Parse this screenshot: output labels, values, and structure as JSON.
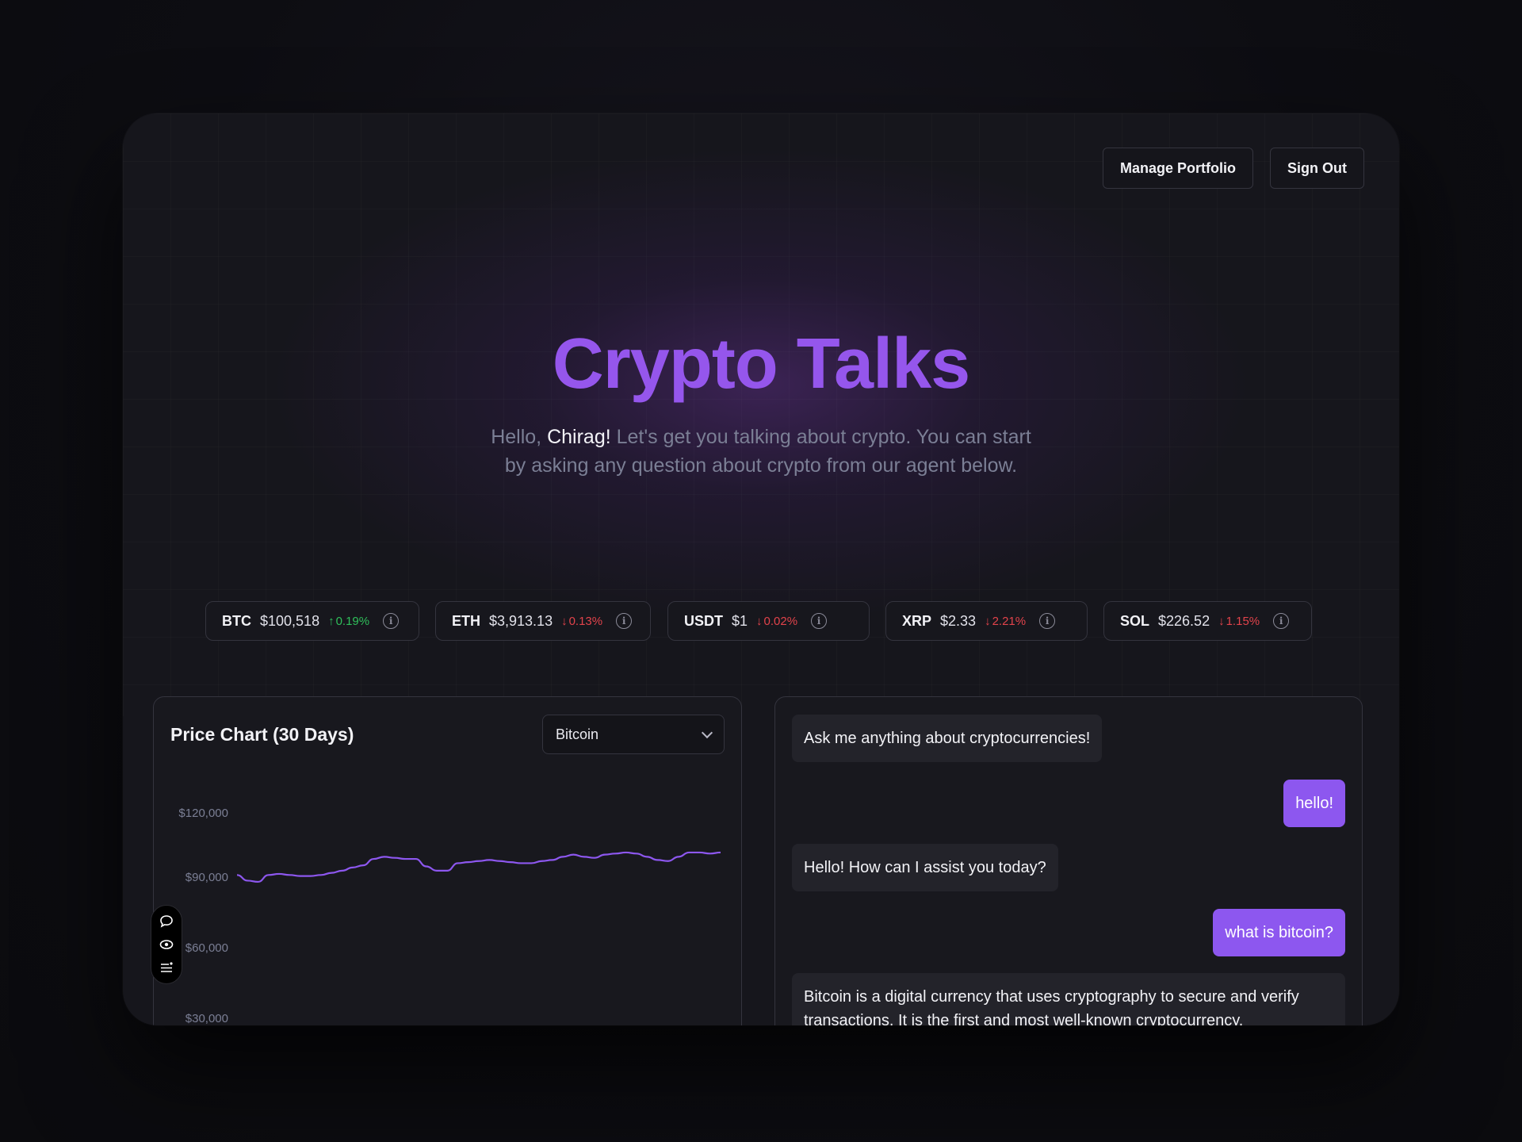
{
  "header": {
    "manage_portfolio_label": "Manage Portfolio",
    "sign_out_label": "Sign Out"
  },
  "hero": {
    "title": "Crypto Talks",
    "greeting_prefix": "Hello, ",
    "user_name": "Chirag!",
    "greeting_rest": " Let's get you talking about crypto. You can start by asking any question about crypto from our agent below."
  },
  "tickers": [
    {
      "symbol": "BTC",
      "price": "$100,518",
      "change": "0.19%",
      "direction": "up"
    },
    {
      "symbol": "ETH",
      "price": "$3,913.13",
      "change": "0.13%",
      "direction": "down"
    },
    {
      "symbol": "USDT",
      "price": "$1",
      "change": "0.02%",
      "direction": "down"
    },
    {
      "symbol": "XRP",
      "price": "$2.33",
      "change": "2.21%",
      "direction": "down"
    },
    {
      "symbol": "SOL",
      "price": "$226.52",
      "change": "1.15%",
      "direction": "down"
    }
  ],
  "chart_panel": {
    "title": "Price Chart (30 Days)",
    "selected_coin": "Bitcoin"
  },
  "chart_data": {
    "type": "line",
    "title": "Price Chart (30 Days)",
    "y_ticks": [
      "$120,000",
      "$90,000",
      "$60,000",
      "$30,000"
    ],
    "y_tick_values": [
      120000,
      90000,
      60000,
      30000
    ],
    "series": [
      {
        "values": [
          91000,
          88500,
          88000,
          91000,
          91500,
          91000,
          90500,
          90500,
          91000,
          92000,
          93000,
          94500,
          95500,
          98500,
          99500,
          99000,
          98500,
          98500,
          95000,
          93000,
          93000,
          96500,
          97000,
          97500,
          98000,
          97500,
          97000,
          96500,
          96500,
          97500,
          98000,
          99500,
          100500,
          99500,
          99000,
          100500,
          101000,
          101500,
          101000,
          99500,
          98000,
          97500,
          99500,
          101500,
          101500,
          101000,
          101500
        ]
      }
    ],
    "colors": {
      "line": "#8d57ef"
    },
    "grid": false
  },
  "chat": {
    "messages": [
      {
        "role": "bot",
        "text": "Ask me anything about cryptocurrencies!"
      },
      {
        "role": "user",
        "text": "hello!"
      },
      {
        "role": "bot",
        "text": "Hello! How can I assist you today?"
      },
      {
        "role": "user",
        "text": "what is bitcoin?"
      },
      {
        "role": "bot",
        "text": "Bitcoin is a digital currency that uses cryptography to secure and verify transactions. It is the first and most well-known cryptocurrency."
      }
    ]
  },
  "side_toolbar": {
    "icons": [
      "chat-bubble-icon",
      "eye-icon",
      "list-settings-icon"
    ]
  },
  "colors": {
    "accent": "#8d57ef",
    "title": "#9556ec",
    "up": "#2fbf5a",
    "down": "#e2434b"
  }
}
